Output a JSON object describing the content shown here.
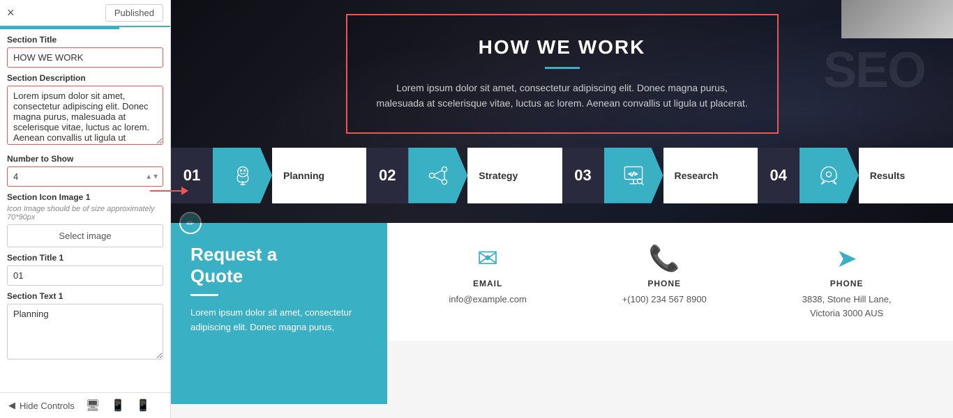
{
  "header": {
    "close_label": "×",
    "published_label": "Published"
  },
  "panel": {
    "section_title_label": "Section Title",
    "section_title_value": "HOW WE WORK",
    "section_desc_label": "Section Description",
    "section_desc_value": "Lorem ipsum dolor sit amet, consectetur adipiscing elit. Donec magna purus, malesuada at scelerisque vitae, luctus ac lorem. Aenean convallis ut ligula ut placerat.",
    "number_to_show_label": "Number to Show",
    "number_to_show_value": "4",
    "section_icon_label": "Section Icon Image 1",
    "icon_hint": "Icon Image should be of size approximately 70*90px",
    "select_image_label": "Select image",
    "section_title1_label": "Section Title 1",
    "section_title1_value": "01",
    "section_text1_label": "Section Text 1",
    "section_text1_value": "Planning"
  },
  "footer": {
    "hide_controls_label": "Hide Controls"
  },
  "main": {
    "section_title": "HOW WE WORK",
    "section_desc": "Lorem ipsum dolor sit amet, consectetur adipiscing elit. Donec magna purus, malesuada at scelerisque vitae, luctus ac lorem. Aenean convallis ut ligula ut placerat.",
    "steps": [
      {
        "number": "01",
        "label": "Planning",
        "icon": "brain"
      },
      {
        "number": "02",
        "label": "Strategy",
        "icon": "nodes"
      },
      {
        "number": "03",
        "label": "Research",
        "icon": "monitor"
      },
      {
        "number": "04",
        "label": "Results",
        "icon": "rocket"
      }
    ],
    "quote": {
      "title": "Request a Quote",
      "text": "Lorem ipsum dolor sit amet, consectetur adipiscing elit. Donec magna purus,"
    },
    "contacts": [
      {
        "icon": "email",
        "label": "EMAIL",
        "value": "info@example.com"
      },
      {
        "icon": "phone",
        "label": "PHONE",
        "value": "+(100) 234 567 8900"
      },
      {
        "icon": "location",
        "label": "PHONE",
        "value": "3838, Stone Hill Lane, Victoria 3000 AUS"
      }
    ]
  }
}
